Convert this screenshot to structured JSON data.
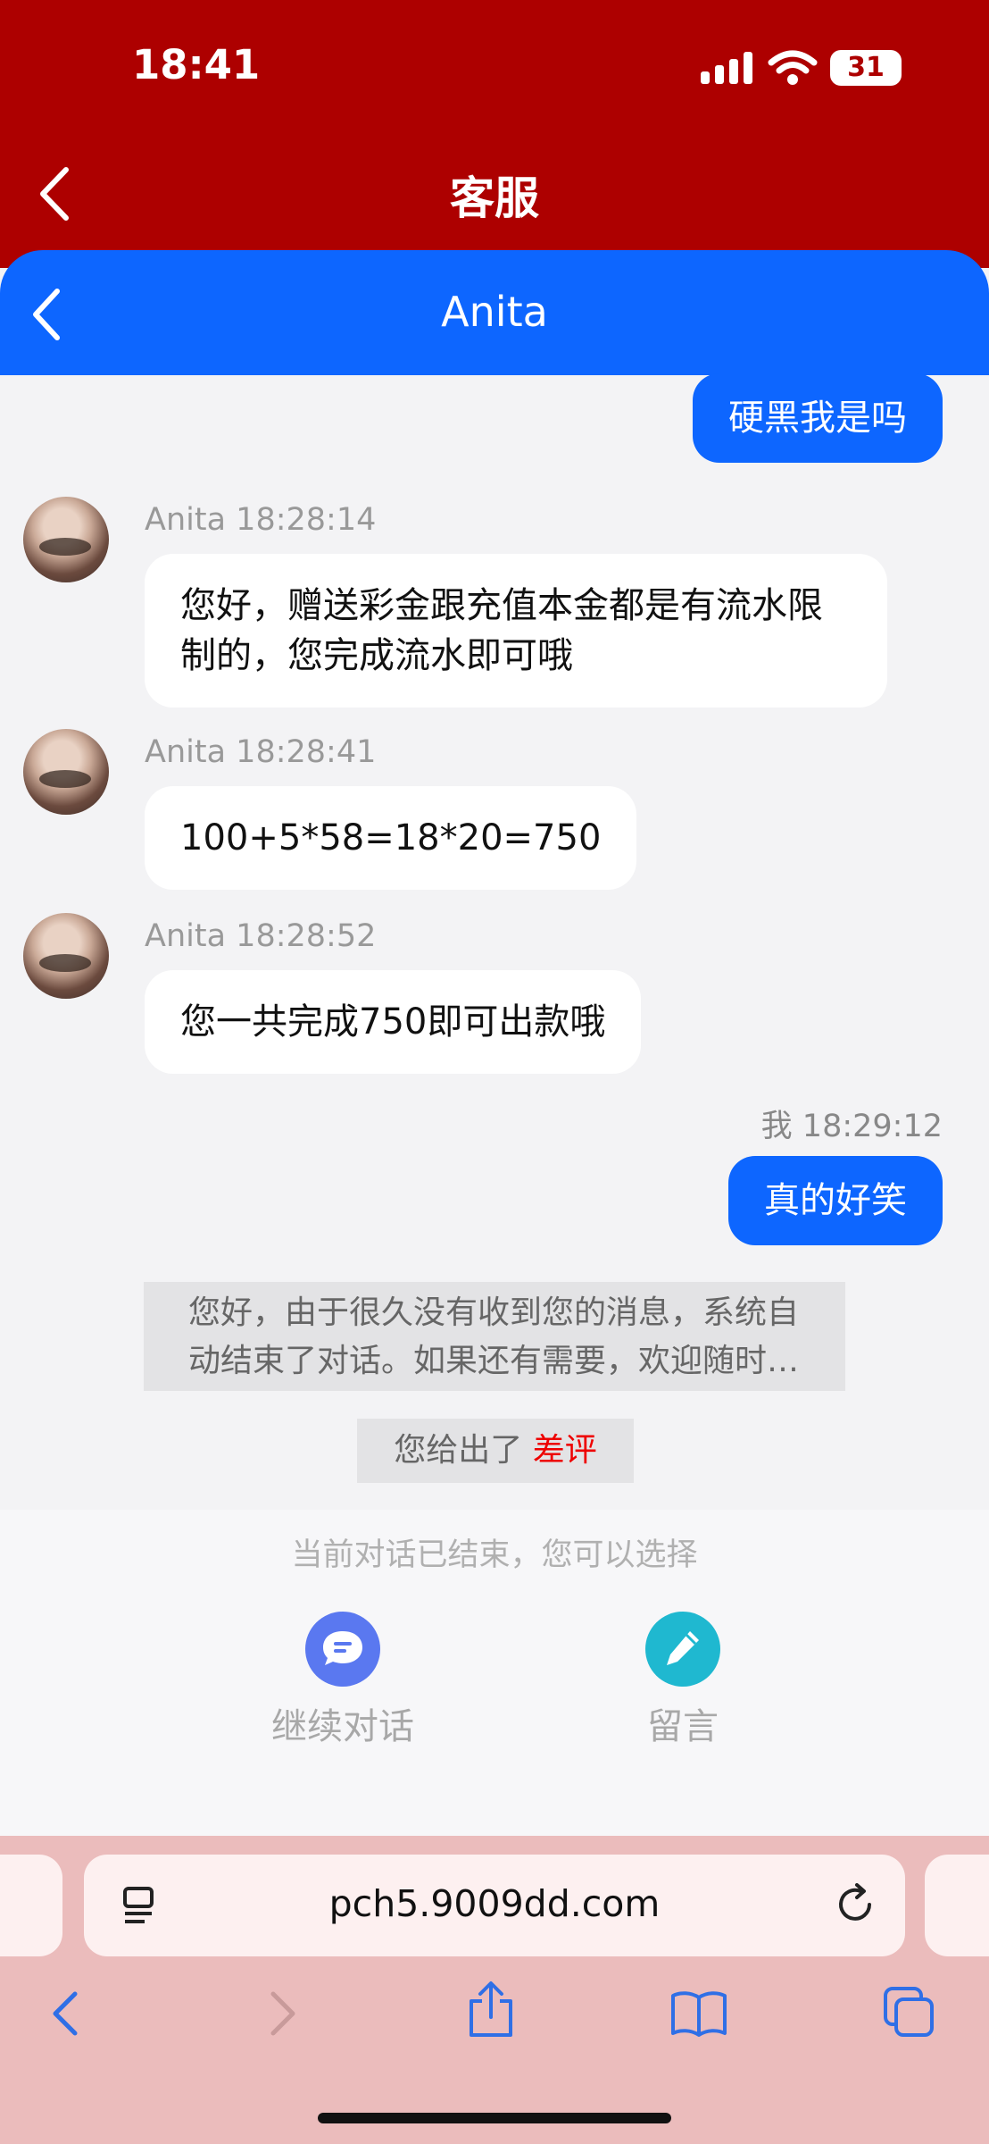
{
  "status_bar": {
    "time": "18:41",
    "battery": "31"
  },
  "header": {
    "title": "客服",
    "back_icon": "chevron-left-icon"
  },
  "chat_header": {
    "title": "Anita",
    "back_icon": "chevron-left-icon"
  },
  "messages": [
    {
      "from": "me",
      "text": "硬黑我是吗"
    },
    {
      "from": "agent",
      "sender": "Anita",
      "time": "18:28:14",
      "text": "您好，赠送彩金跟充值本金都是有流水限制的，您完成流水即可哦"
    },
    {
      "from": "agent",
      "sender": "Anita",
      "time": "18:28:41",
      "text": "100+5*58=18*20=750"
    },
    {
      "from": "agent",
      "sender": "Anita",
      "time": "18:28:52",
      "text": "您一共完成750即可出款哦"
    },
    {
      "from": "me",
      "sender": "我",
      "time": "18:29:12",
      "text": "真的好笑"
    }
  ],
  "system_message": "您好，由于很久没有收到您的消息，系统自动结束了对话。如果还有需要，欢迎随时…",
  "rating": {
    "prefix": "您给出了",
    "value": "差评",
    "value_color": "#ee0000"
  },
  "footer": {
    "ended_text": "当前对话已结束，您可以选择",
    "continue_label": "继续对话",
    "leave_message_label": "留言"
  },
  "browser": {
    "url": "pch5.9009dd.com"
  },
  "colors": {
    "header_red": "#ad0000",
    "chat_blue": "#0d66ff"
  }
}
